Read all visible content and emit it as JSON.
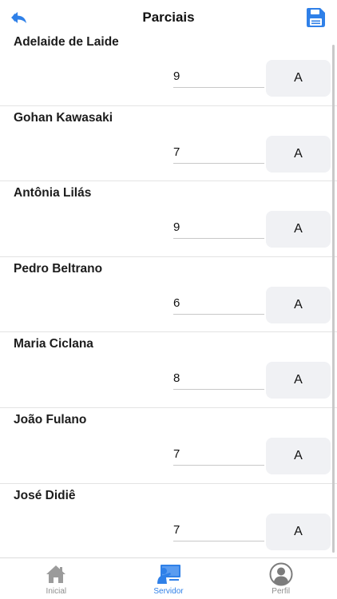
{
  "header": {
    "title": "Parciais",
    "back_icon": "reply-arrow-icon",
    "save_icon": "floppy-disk-icon",
    "accent": "#2f80e8"
  },
  "students": [
    {
      "name": "Adelaide de Laide",
      "grade": "9",
      "button": "A"
    },
    {
      "name": "Gohan Kawasaki",
      "grade": "7",
      "button": "A"
    },
    {
      "name": "Antônia Lilás",
      "grade": "9",
      "button": "A"
    },
    {
      "name": "Pedro Beltrano",
      "grade": "6",
      "button": "A"
    },
    {
      "name": "Maria Ciclana",
      "grade": "8",
      "button": "A"
    },
    {
      "name": "João Fulano",
      "grade": "7",
      "button": "A"
    },
    {
      "name": "José Didiê",
      "grade": "7",
      "button": "A"
    }
  ],
  "tabbar": {
    "tabs": [
      {
        "label": "Inicial",
        "icon": "home-icon",
        "active": false
      },
      {
        "label": "Servidor",
        "icon": "teacher-board-icon",
        "active": true
      },
      {
        "label": "Perfil",
        "icon": "user-circle-icon",
        "active": false
      }
    ]
  }
}
